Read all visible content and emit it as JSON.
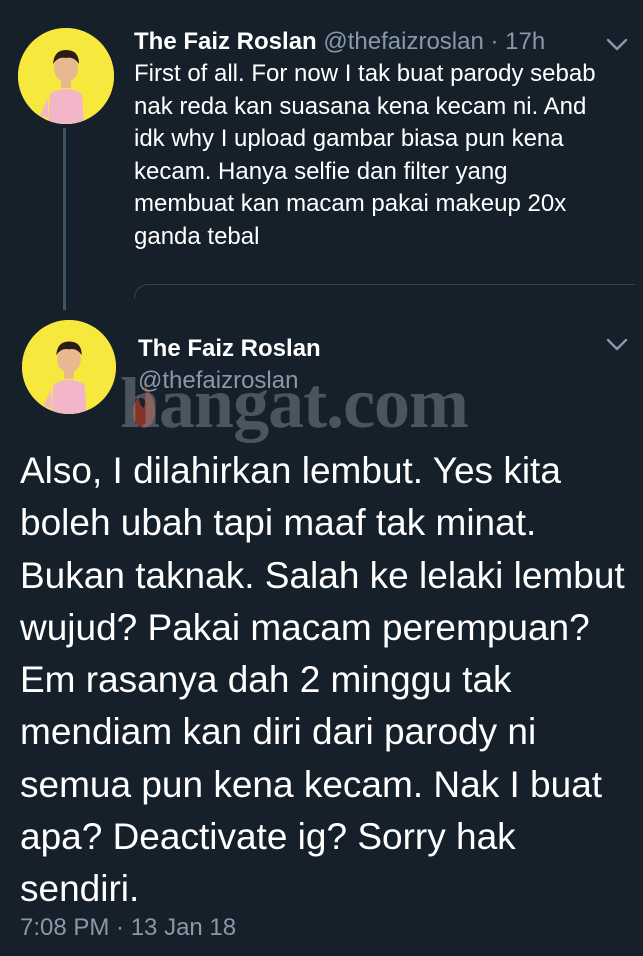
{
  "tweet1": {
    "author_name": "The Faiz Roslan",
    "author_handle": "@thefaizroslan",
    "separator": "·",
    "time": "17h",
    "body": "First of all. For now I tak buat parody sebab nak reda kan suasana kena kecam ni. And idk why I upload gambar biasa pun kena kecam. Hanya selfie dan filter yang membuat kan macam pakai makeup 20x ganda tebal"
  },
  "tweet2": {
    "author_name": "The Faiz Roslan",
    "author_handle": "@thefaizroslan",
    "body": "Also, I dilahirkan lembut. Yes kita boleh ubah tapi maaf tak minat. Bukan taknak. Salah ke lelaki lembut wujud? Pakai macam perempuan? Em rasanya dah 2 minggu tak mendiam kan diri dari parody ni semua pun kena kecam. Nak I buat apa? Deactivate ig? Sorry hak sendiri.",
    "timestamp": "7:08 PM · 13 Jan 18"
  },
  "watermark": {
    "text": "hangat.com"
  },
  "icons": {
    "menu": "chevron-down-icon",
    "avatar": "avatar"
  },
  "colors": {
    "background": "#15202b",
    "secondary_text": "#8899a6",
    "avatar_bg": "#f6e83c"
  }
}
